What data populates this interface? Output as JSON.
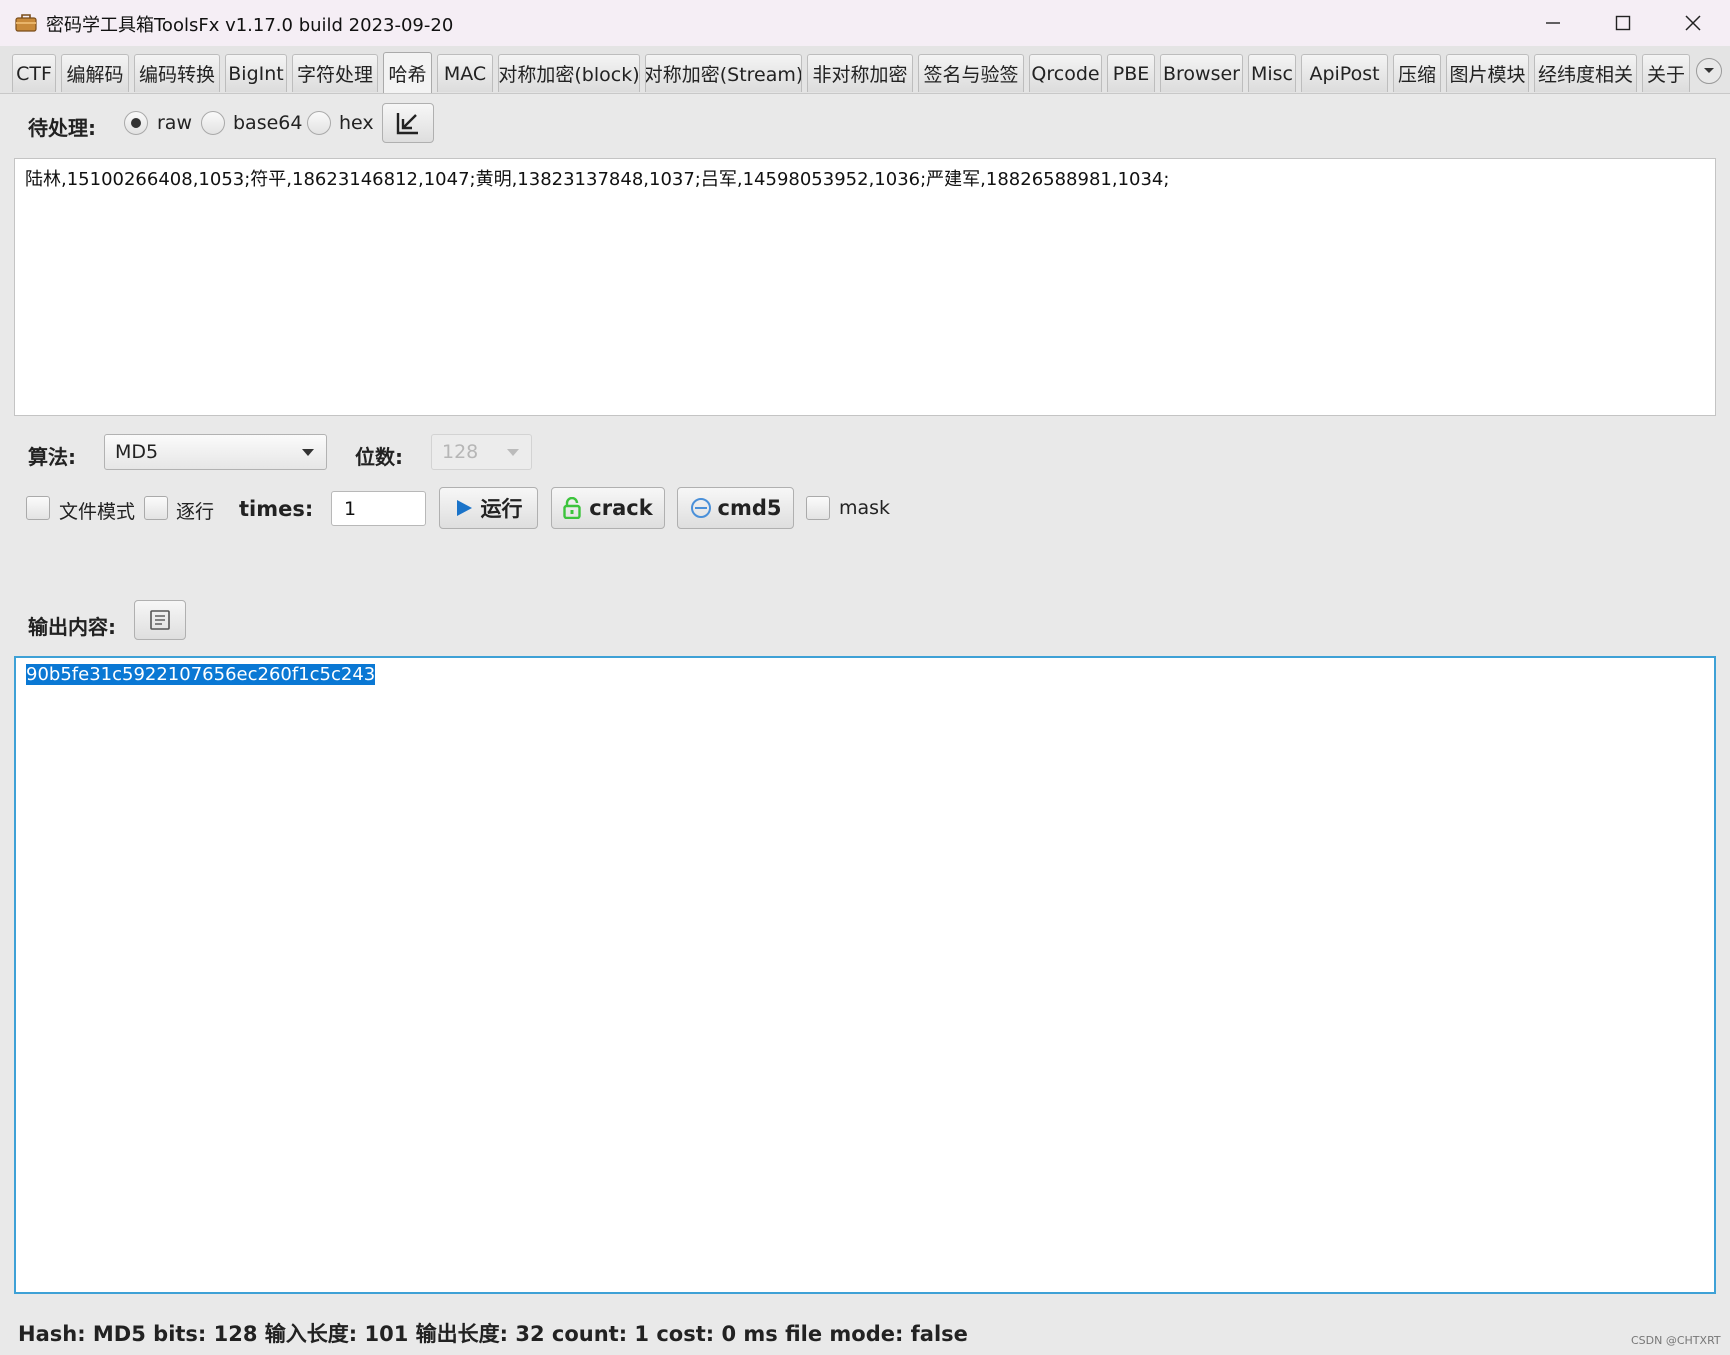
{
  "window": {
    "title": "密码学工具箱ToolsFx v1.17.0 build 2023-09-20"
  },
  "tabs": [
    {
      "label": "CTF"
    },
    {
      "label": "编解码"
    },
    {
      "label": "编码转换"
    },
    {
      "label": "BigInt"
    },
    {
      "label": "字符处理"
    },
    {
      "label": "哈希"
    },
    {
      "label": "MAC"
    },
    {
      "label": "对称加密(block)"
    },
    {
      "label": "对称加密(Stream)"
    },
    {
      "label": "非对称加密"
    },
    {
      "label": "签名与验签"
    },
    {
      "label": "Qrcode"
    },
    {
      "label": "PBE"
    },
    {
      "label": "Browser"
    },
    {
      "label": "Misc"
    },
    {
      "label": "ApiPost"
    },
    {
      "label": "压缩"
    },
    {
      "label": "图片模块"
    },
    {
      "label": "经纬度相关"
    },
    {
      "label": "关于"
    }
  ],
  "active_tab": "哈希",
  "input_section": {
    "label": "待处理:",
    "encoding_options": [
      "raw",
      "base64",
      "hex"
    ],
    "selected_encoding": "raw",
    "input_text": "陆林,15100266408,1053;符平,18623146812,1047;黄明,13823137848,1037;吕军,14598053952,1036;严建军,18826588981,1034;"
  },
  "algorithm": {
    "label": "算法:",
    "value": "MD5",
    "bits_label": "位数:",
    "bits_value": "128"
  },
  "options": {
    "file_mode_label": "文件模式",
    "line_by_line_label": "逐行",
    "times_label": "times:",
    "times_value": "1",
    "run_label": "运行",
    "crack_label": "crack",
    "cmd5_label": "cmd5",
    "mask_label": "mask"
  },
  "output_section": {
    "label": "输出内容:",
    "output_text": "90b5fe31c5922107656ec260f1c5c243"
  },
  "status": {
    "text": "Hash: MD5 bits: 128 输入长度: 101  输出长度: 32  count: 1 cost: 0 ms  file mode: false"
  },
  "watermark": "CSDN @CHTXRT",
  "colors": {
    "accent": "#3ea1d6",
    "selection": "#0a78d4",
    "run_icon": "#1a73c9",
    "crack_icon": "#3cc43c",
    "cmd5_icon": "#4a90d9"
  },
  "icons": {
    "app": "toolbox-icon",
    "import": "arrow-down-left-icon",
    "copy": "copy-icon",
    "run": "play-icon",
    "crack": "unlock-icon",
    "cmd5": "circle-minus-icon"
  }
}
